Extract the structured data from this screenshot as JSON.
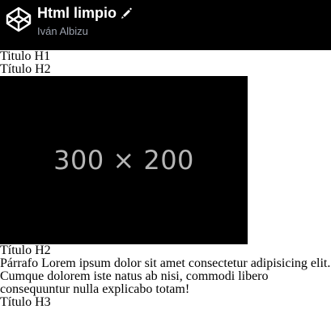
{
  "header": {
    "title": "Html limpio",
    "author": "Iván Albizu",
    "logo_icon": "codepen-logo-icon",
    "edit_icon": "pencil-icon",
    "background": "#000000"
  },
  "content": {
    "h1": "Titulo H1",
    "h2_first": "Título H2",
    "image_placeholder_text": "300 × 200",
    "h2_second": "Título H2",
    "paragraph": "Párrafo Lorem ipsum dolor sit amet consectetur adipisicing elit. Cumque dolorem iste natus ab nisi, commodi libero consequuntur nulla explicabo totam!",
    "h3": "Título H3"
  }
}
